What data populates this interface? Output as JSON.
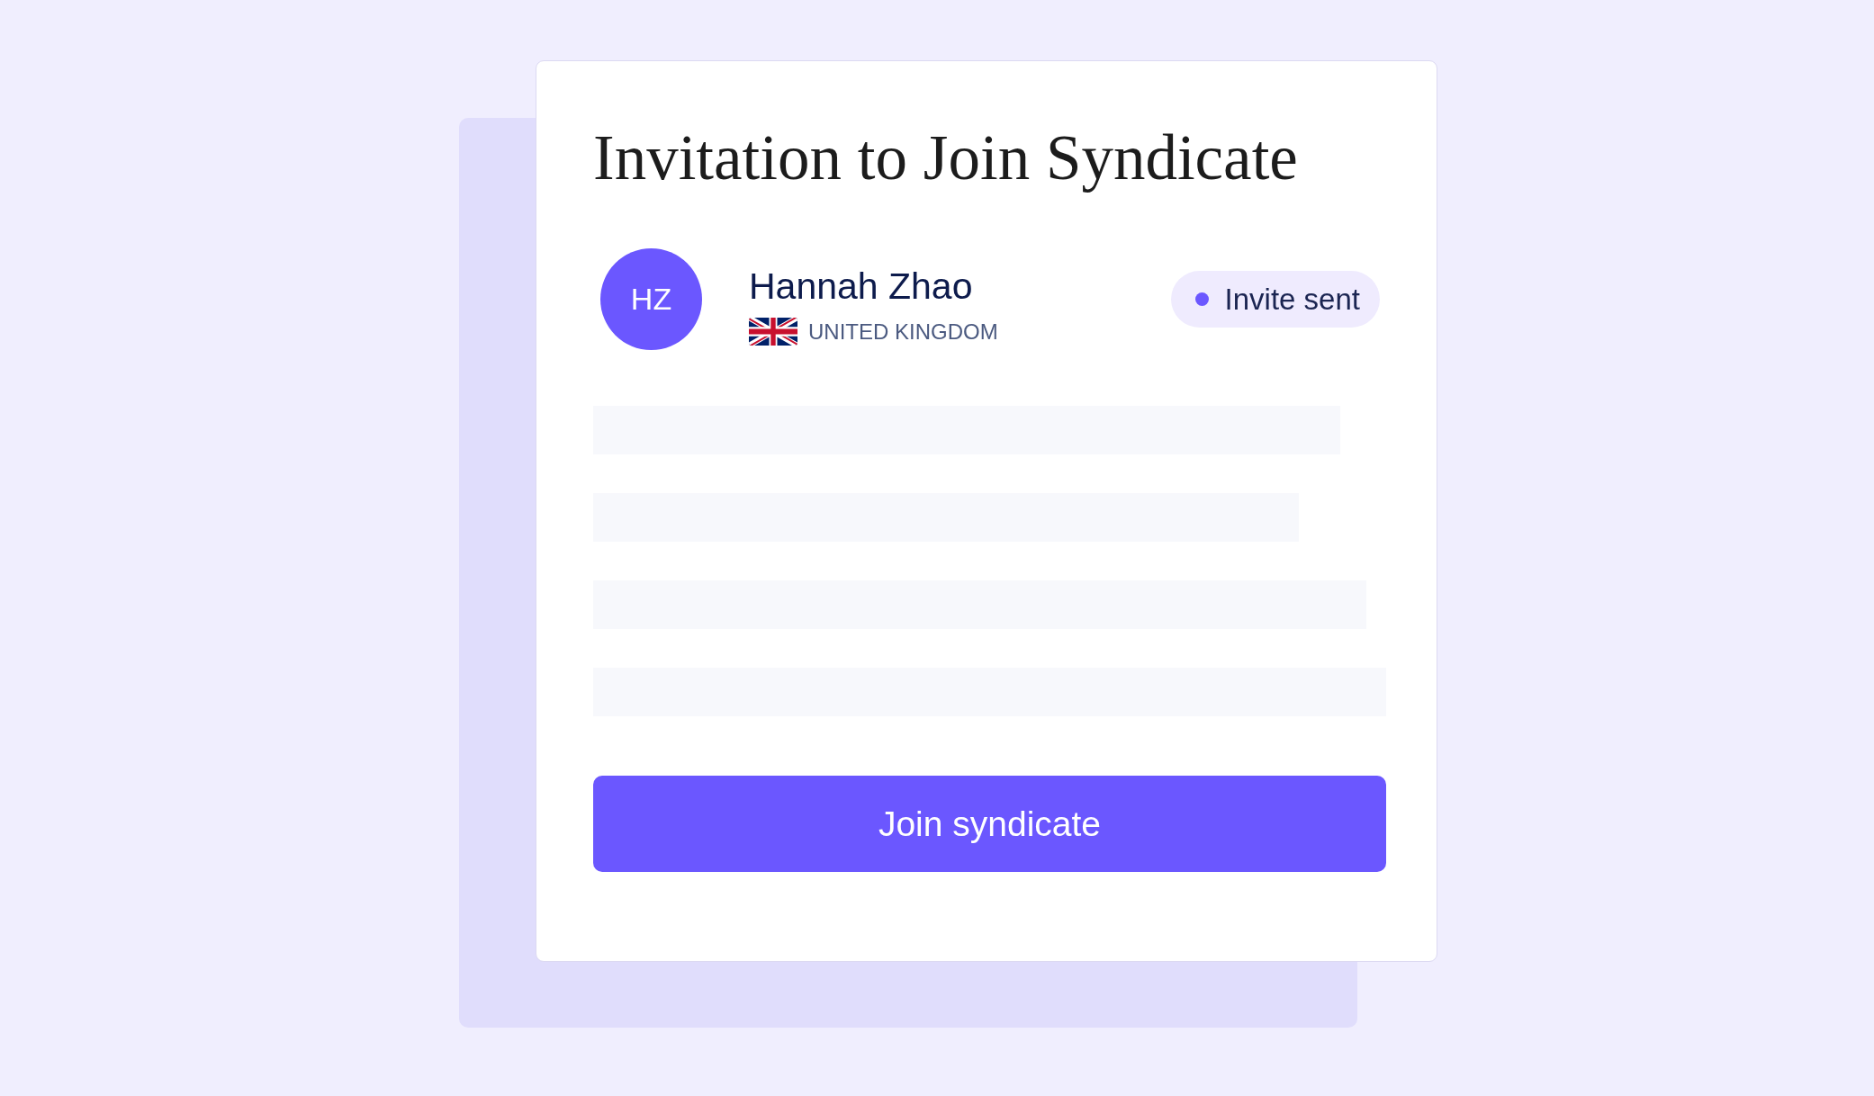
{
  "invitation": {
    "title": "Invitation to Join Syndicate",
    "invitee": {
      "initials": "HZ",
      "name": "Hannah Zhao",
      "country": "UNITED KINGDOM"
    },
    "status": {
      "label": "Invite sent"
    },
    "button": {
      "label": "Join syndicate"
    }
  }
}
